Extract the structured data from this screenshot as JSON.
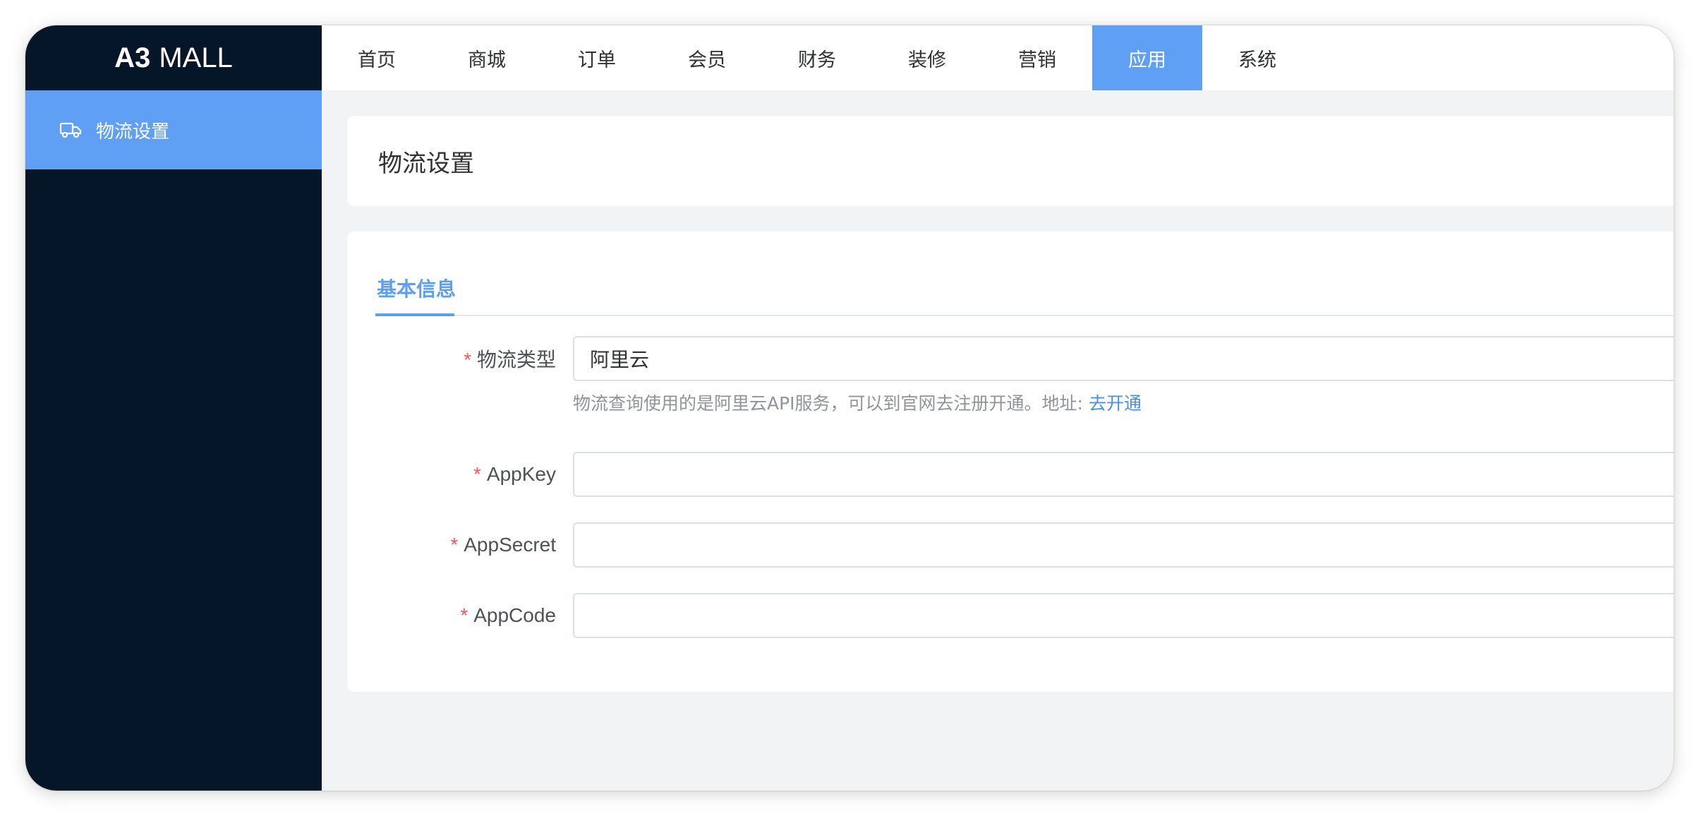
{
  "logo": {
    "bold": "A3",
    "rest": "MALL"
  },
  "sidebar": {
    "items": [
      {
        "label": "物流设置",
        "icon": "truck-icon"
      }
    ]
  },
  "topnav": {
    "items": [
      "首页",
      "商城",
      "订单",
      "会员",
      "财务",
      "装修",
      "营销",
      "应用",
      "系统"
    ],
    "active": "应用"
  },
  "page": {
    "title": "物流设置"
  },
  "form": {
    "tab": "基本信息",
    "fields": [
      {
        "label": "物流类型",
        "value": "阿里云",
        "required": true
      },
      {
        "label": "AppKey",
        "value": "",
        "required": true
      },
      {
        "label": "AppSecret",
        "value": "",
        "required": true
      },
      {
        "label": "AppCode",
        "value": "",
        "required": true
      }
    ],
    "required_mark": "*",
    "hint_text": "物流查询使用的是阿里云API服务，可以到官网去注册开通。地址: ",
    "hint_link": "去开通"
  },
  "colors": {
    "sidebar_bg": "#061629",
    "accent": "#5fa0f5",
    "link": "#4a90e2",
    "required": "#f05a5a"
  }
}
